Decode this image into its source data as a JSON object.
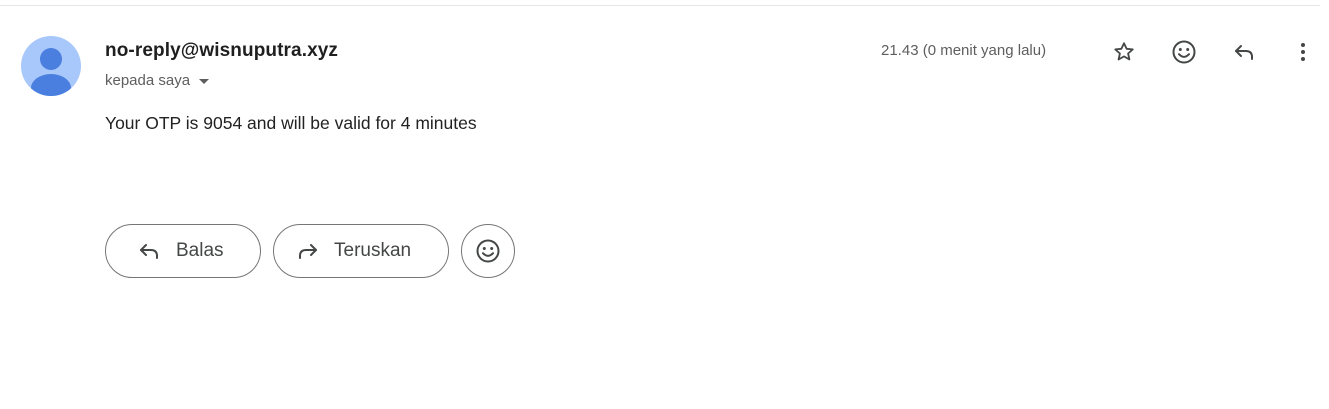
{
  "message": {
    "sender": "no-reply@wisnuputra.xyz",
    "recipient": "kepada saya",
    "timestamp": "21.43 (0 menit yang lalu)",
    "body": "Your OTP is 9054 and will be valid for 4 minutes"
  },
  "header_actions": [
    {
      "icon": "star-icon"
    },
    {
      "icon": "emoji-reaction-icon"
    },
    {
      "icon": "reply-icon"
    },
    {
      "icon": "more-vert-icon"
    }
  ],
  "actions": {
    "reply_label": "Balas",
    "forward_label": "Teruskan",
    "emoji_icon": "add-emoji-icon"
  },
  "colors": {
    "avatar_bg": "#a8c7fa",
    "avatar_fg": "#4a7fe0",
    "text": "#1f1f1f",
    "muted": "#5e5e5e",
    "outline": "#747775"
  }
}
